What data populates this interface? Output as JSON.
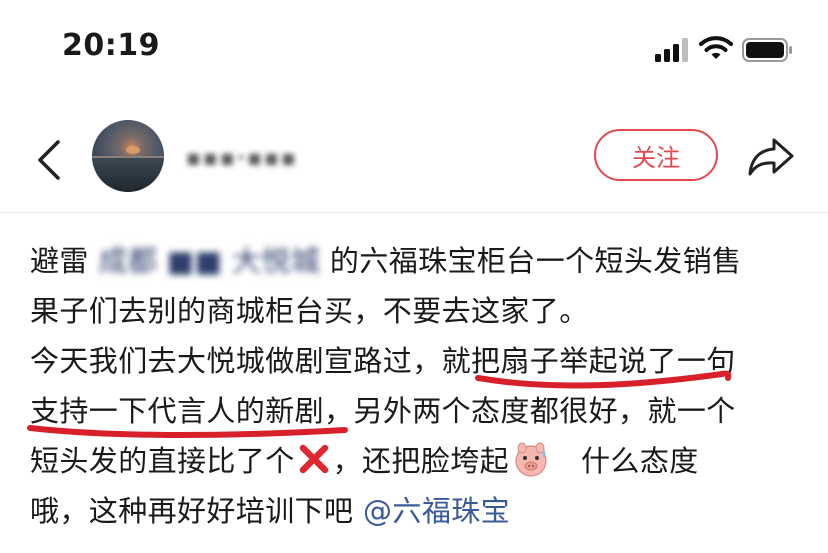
{
  "status_bar": {
    "time": "20:19",
    "icons": [
      "signal-icon",
      "wifi-icon",
      "battery-icon"
    ]
  },
  "header": {
    "back_icon": "chevron-left-icon",
    "username": "▪︎▪︎▪︎·▪︎▪︎▪︎",
    "follow_label": "关注",
    "share_icon": "share-arrow-icon",
    "accent_color": "#e4484f"
  },
  "post": {
    "line1_start": "避雷",
    "line1_blurred": "成都 ■■ 大悦城",
    "line1_end": "的六福珠宝柜台一个短头发销售",
    "line2": "果子们去别的商城柜台买，不要去这家了。",
    "line3_start": "今天我们去大悦城做剧宣路过，",
    "line3_underlined": "就把扇子举起说了",
    "line3_end": "一句",
    "line4_underlined": "支持一下代言人的新剧",
    "line4_end": "，另外两个态度都很好，就一个",
    "line5_start": "短头发的直接比了个",
    "line5_mid": "，还把脸垮起",
    "line5_end": "什么态度",
    "line6_start": "哦，这种再好好培训下吧",
    "mention": "@六福珠宝",
    "annotation_color": "#d8202a",
    "mention_color": "#3a5a9a"
  }
}
